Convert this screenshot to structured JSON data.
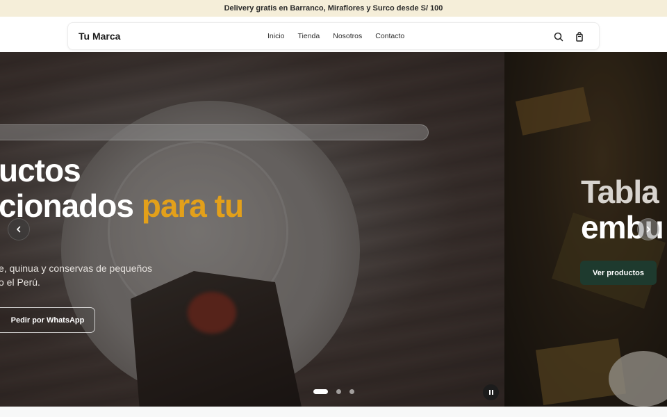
{
  "announcement": {
    "text": "Delivery gratis en Barranco, Miraflores y Surco desde S/ 100"
  },
  "header": {
    "brand": "Tu Marca",
    "nav": [
      {
        "label": "Inicio"
      },
      {
        "label": "Tienda"
      },
      {
        "label": "Nosotros"
      },
      {
        "label": "Contacto"
      }
    ],
    "icons": [
      "search-icon",
      "shopping-bag-icon"
    ]
  },
  "hero": {
    "slides": [
      {
        "title_line1": "uctos",
        "title_line2_main": "cionados",
        "title_line2_accent": "para tu",
        "subtitle_line1": "e, quinua y conservas de pequeños",
        "subtitle_line2": "o el Perú.",
        "cta": "Pedir por WhatsApp"
      },
      {
        "title_line1": "Tabla",
        "title_line2": "embu",
        "cta": "Ver productos"
      }
    ],
    "accent_color": "#e3a01a",
    "active_slide": 1,
    "slide_count": 3,
    "controls": {
      "prev_icon": "chevron-left-icon",
      "next_icon": "chevron-right-icon",
      "pause_icon": "pause-icon"
    }
  }
}
